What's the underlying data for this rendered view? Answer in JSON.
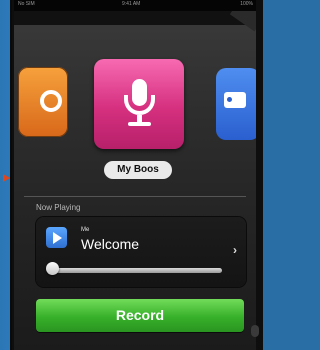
{
  "status_bar": {
    "carrier": "No SIM",
    "time": "9:41 AM",
    "battery": "100%"
  },
  "carousel": {
    "selected_app": "My Boos"
  },
  "now_playing": {
    "label": "Now Playing",
    "artist": "Me",
    "title": "Welcome",
    "progress": 0.02
  },
  "actions": {
    "record_label": "Record"
  }
}
